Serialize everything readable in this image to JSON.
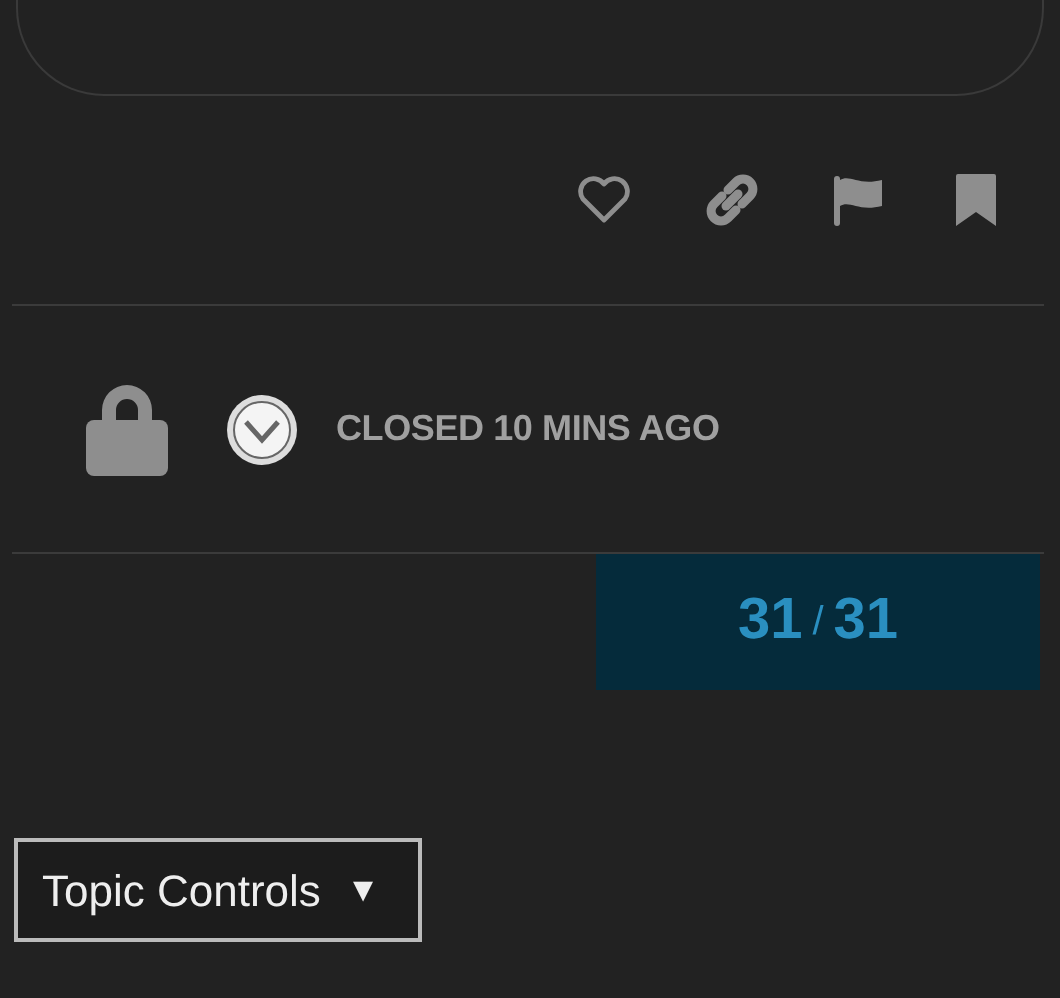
{
  "post_actions": [
    {
      "kind": "like"
    },
    {
      "kind": "link"
    },
    {
      "kind": "flag"
    },
    {
      "kind": "bookmark"
    }
  ],
  "closed_notice": {
    "text": "CLOSED 10 MINS AGO"
  },
  "progress": {
    "current": "31",
    "separator": "/",
    "total": "31"
  },
  "topic_controls": {
    "label": "Topic Controls",
    "caret": "▾"
  }
}
